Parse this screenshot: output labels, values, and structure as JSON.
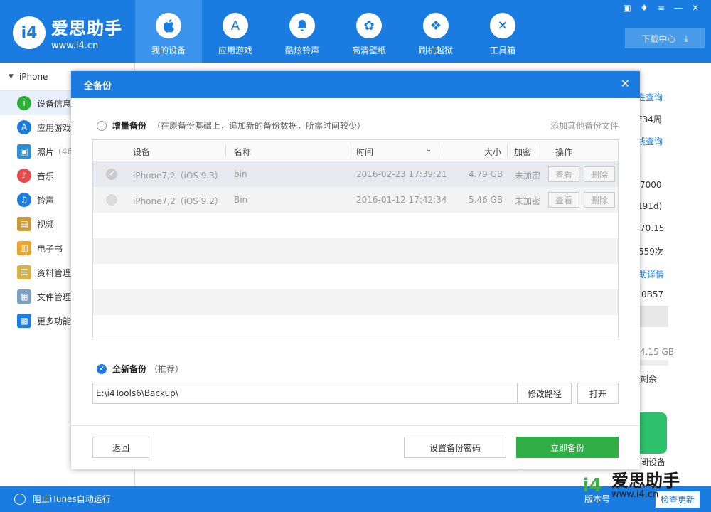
{
  "app": {
    "logo_mark": "i4",
    "logo_title": "爱思助手",
    "logo_url": "www.i4.cn",
    "download_label": "下载中心"
  },
  "nav": [
    {
      "label": "我的设备",
      "icon": "apple-icon",
      "glyph": ""
    },
    {
      "label": "应用游戏",
      "icon": "appstore-icon",
      "glyph": "A"
    },
    {
      "label": "酷炫铃声",
      "icon": "bell-icon",
      "glyph": "🔔"
    },
    {
      "label": "高清壁纸",
      "icon": "flower-icon",
      "glyph": "✿"
    },
    {
      "label": "刷机越狱",
      "icon": "dropbox-icon",
      "glyph": "❖"
    },
    {
      "label": "工具箱",
      "icon": "tools-icon",
      "glyph": "✕"
    }
  ],
  "sidebar": {
    "device": "iPhone",
    "items": [
      {
        "label": "设备信息",
        "glyph": "i",
        "color": "#2eae36"
      },
      {
        "label": "应用游戏",
        "glyph": "A",
        "color": "#1a7ce0"
      },
      {
        "label": "照片",
        "glyph": "▣",
        "color": "#2b8fd8"
      },
      {
        "label": "音乐",
        "glyph": "♪",
        "color": "#e64a4a"
      },
      {
        "label": "铃声",
        "glyph": "♫",
        "color": "#1a7ce0"
      },
      {
        "label": "视频",
        "glyph": "▤",
        "color": "#c89a3a"
      },
      {
        "label": "电子书",
        "glyph": "▥",
        "color": "#e9a52f"
      },
      {
        "label": "资料管理",
        "glyph": "☰",
        "color": "#d8b044"
      },
      {
        "label": "文件管理",
        "glyph": "▦",
        "color": "#7aa0c4"
      },
      {
        "label": "更多功能",
        "glyph": "▩",
        "color": "#1a7ce0"
      }
    ],
    "photo_count": "(46"
  },
  "right": {
    "v1": "胜查询",
    "v2": "E34周",
    "v3": "线查询",
    "v4": "7000",
    "v5": "191d)",
    "v6": "70.15",
    "v7": "559次",
    "v8": "助详情",
    "v9": "0B57",
    "v10": "4.15 GB",
    "v11": "剩余",
    "v12": "闭设备"
  },
  "dialog": {
    "title": "全备份",
    "incremental_label": "增量备份",
    "incremental_hint": "（在原备份基础上，追加新的备份数据，所需时间较少）",
    "add_other": "添加其他备份文件",
    "columns": {
      "device": "设备",
      "name": "名称",
      "time": "时间",
      "size": "大小",
      "encrypt": "加密",
      "action": "操作"
    },
    "rows": [
      {
        "device": "iPhone7,2（iOS 9.3）",
        "name": "bin",
        "time": "2016-02-23 17:39:21",
        "size": "4.79 GB",
        "encrypt": "未加密",
        "view": "查看",
        "delete": "删除"
      },
      {
        "device": "iPhone7,2（iOS 9.2）",
        "name": "Bin",
        "time": "2016-01-12 17:42:34",
        "size": "5.46 GB",
        "encrypt": "未加密",
        "view": "查看",
        "delete": "删除"
      }
    ],
    "full_label": "全新备份",
    "full_hint": "（推荐）",
    "path": "E:\\i4Tools6\\Backup\\",
    "change_path": "修改路径",
    "open": "打开",
    "back": "返回",
    "set_password": "设置备份密码",
    "backup_now": "立即备份"
  },
  "bottom": {
    "itunes": "阻止iTunes自动运行",
    "version": "版本号",
    "update": "检查更新"
  },
  "watermark": {
    "mark": "i4",
    "title": "爱思助手",
    "url": "www.i4.cn"
  }
}
